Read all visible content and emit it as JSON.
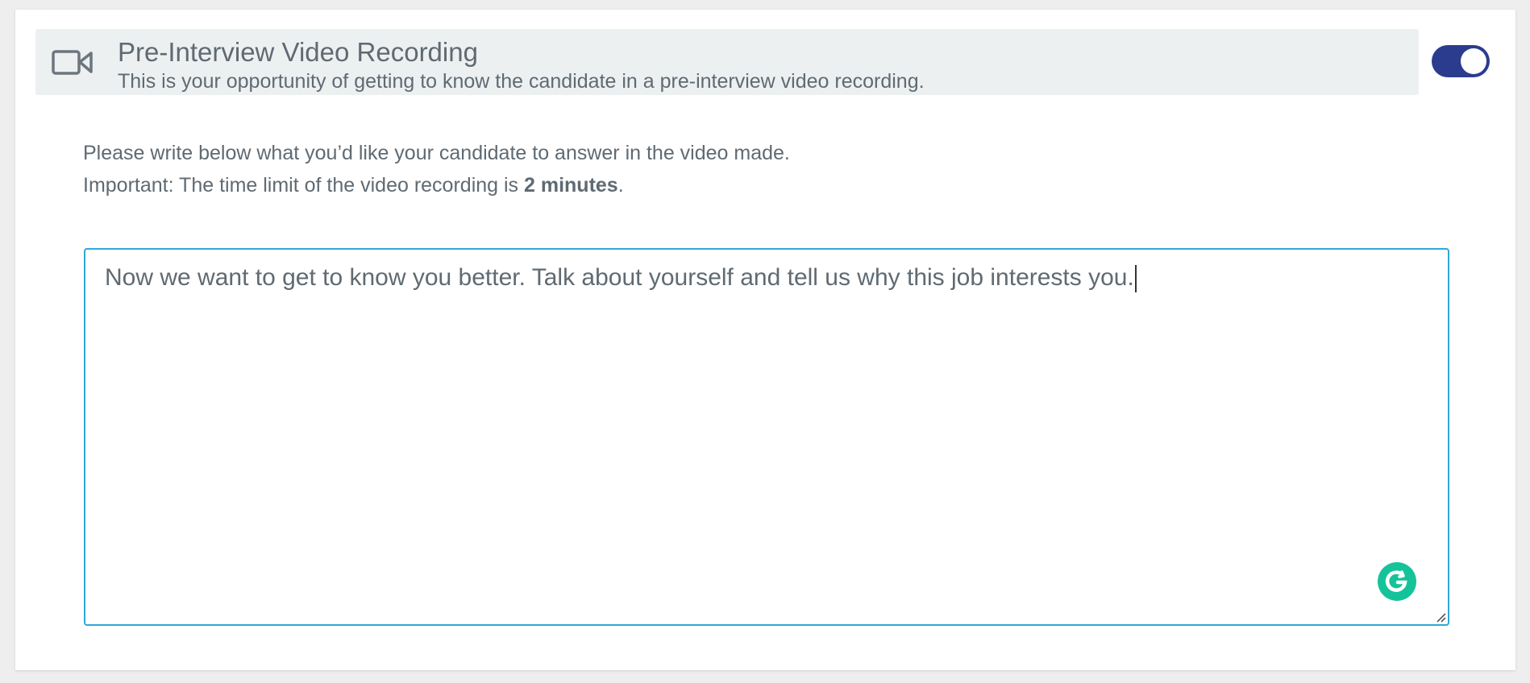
{
  "section": {
    "title": "Pre-Interview Video Recording",
    "subtitle": "This is your opportunity of getting to know the candidate in a pre-interview video recording.",
    "icon": "video-camera-icon",
    "toggle_on": true,
    "toggle_color": "#2b3c8f"
  },
  "instructions": {
    "line1": "Please write below what you’d like your candidate to answer in the video made.",
    "line2_prefix": "Important: The time limit of the video recording is ",
    "line2_bold": "2 minutes",
    "line2_suffix": "."
  },
  "question_field": {
    "value": "Now we want to get to know you better. Talk about yourself and tell us why this job interests you.",
    "border_color": "#2fa7d8"
  },
  "grammarly": {
    "icon": "grammarly-icon",
    "color": "#15c39a"
  }
}
